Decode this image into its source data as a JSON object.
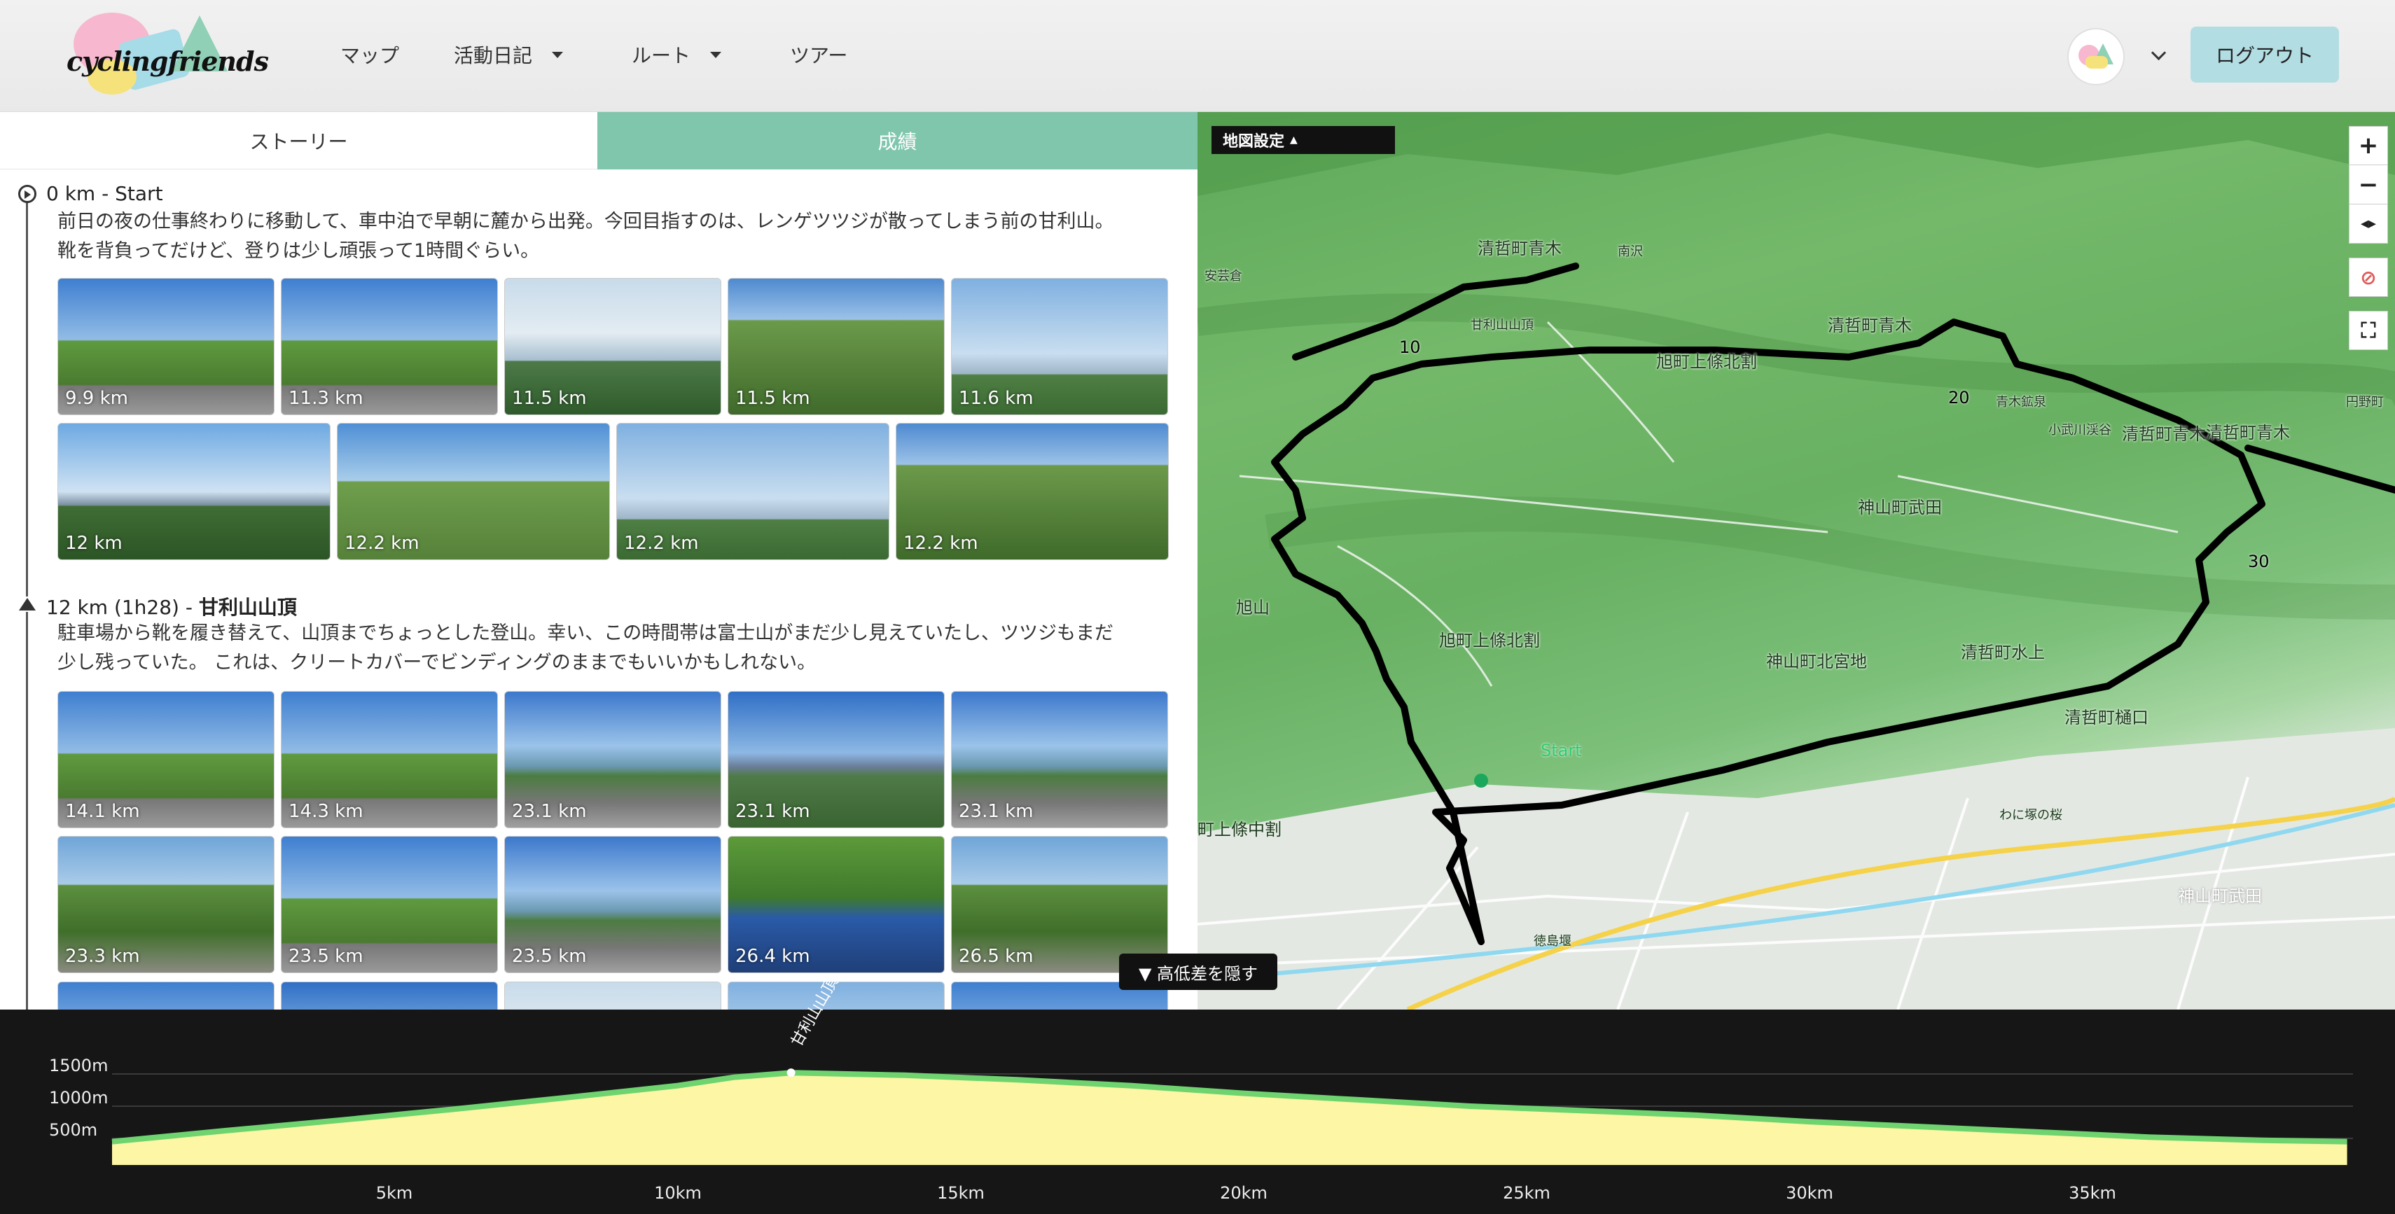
{
  "header": {
    "logo_text": "cyclingfriends",
    "nav": [
      {
        "label": "マップ",
        "has_dropdown": false
      },
      {
        "label": "活動日記",
        "has_dropdown": true
      },
      {
        "label": "ルート",
        "has_dropdown": true
      },
      {
        "label": "ツアー",
        "has_dropdown": false
      }
    ],
    "logout_label": "ログアウト"
  },
  "tabs": {
    "story": "ストーリー",
    "results": "成績",
    "active": "story"
  },
  "story": {
    "waypoints": [
      {
        "distance": "0 km",
        "separator": "-",
        "name": "Start",
        "text_lines": [
          "前日の夜の仕事終わりに移動して、車中泊で早朝に麓から出発。今回目指すのは、レンゲツツジが散ってしまう前の甘利山。",
          "靴を背負ってだけど、登りは少し頑張って1時間ぐらい。"
        ],
        "photos_row1": [
          "9.9 km",
          "11.3 km",
          "11.5 km",
          "11.5 km",
          "11.6 km"
        ],
        "photos_row2": [
          "12 km",
          "12.2 km",
          "12.2 km",
          "12.2 km"
        ]
      },
      {
        "distance": "12 km",
        "time": "(1h28)",
        "separator": "-",
        "name": "甘利山山頂",
        "text_lines": [
          "駐車場から靴を履き替えて、山頂までちょっとした登山。幸い、この時間帯は富士山がまだ少し見えていたし、ツツジもまだ",
          "少し残っていた。 これは、クリートカバーでビンディングのままでもいいかもしれない。"
        ],
        "photos_row1": [
          "14.1 km",
          "14.3 km",
          "23.1 km",
          "23.1 km",
          "23.1 km"
        ],
        "photos_row2": [
          "23.3 km",
          "23.5 km",
          "23.5 km",
          "26.4 km",
          "26.5 km"
        ]
      }
    ]
  },
  "map": {
    "settings_label": "地図設定",
    "settings_arrow": "▲",
    "controls": [
      "+",
      "−"
    ],
    "labels": {
      "l1": "清哲町青木",
      "l2": "甘利山山頂",
      "l3": "旭町上條北割",
      "l4": "清哲町青木",
      "l5": "神山町武田",
      "l6": "清哲町青木",
      "l7": "旭山",
      "l8": "旭町上條北割",
      "l9": "神山町北宮地",
      "l10": "清哲町水上",
      "l11": "清哲町樋口",
      "l12": "Start",
      "l13": "町上條中割",
      "l14": "神山町武田",
      "l15": "徳島堰",
      "l16": "わに塚の桜",
      "l17": "清哲町青木",
      "l18": "安芸倉",
      "l19": "南沢",
      "l20": "円野町",
      "l21": "小武川渓谷",
      "l22": "青木鉱泉"
    },
    "km_markers": [
      "10",
      "20",
      "30"
    ]
  },
  "elevation": {
    "toggle_label": "▼ 高低差を隠す",
    "peak_label": "甘利山山頂",
    "y_ticks": [
      "1500m",
      "1000m",
      "500m"
    ],
    "x_ticks": [
      "5km",
      "10km",
      "15km",
      "20km",
      "25km",
      "30km",
      "35km"
    ],
    "profile": [
      [
        0,
        450
      ],
      [
        2,
        620
      ],
      [
        4,
        780
      ],
      [
        6,
        950
      ],
      [
        8,
        1130
      ],
      [
        10,
        1320
      ],
      [
        11,
        1450
      ],
      [
        12,
        1520
      ],
      [
        13,
        1500
      ],
      [
        14,
        1480
      ],
      [
        16,
        1410
      ],
      [
        18,
        1320
      ],
      [
        20,
        1200
      ],
      [
        22,
        1100
      ],
      [
        24,
        1000
      ],
      [
        26,
        930
      ],
      [
        28,
        860
      ],
      [
        30,
        760
      ],
      [
        32,
        680
      ],
      [
        34,
        600
      ],
      [
        36,
        520
      ],
      [
        38,
        470
      ],
      [
        39.5,
        450
      ]
    ]
  }
}
